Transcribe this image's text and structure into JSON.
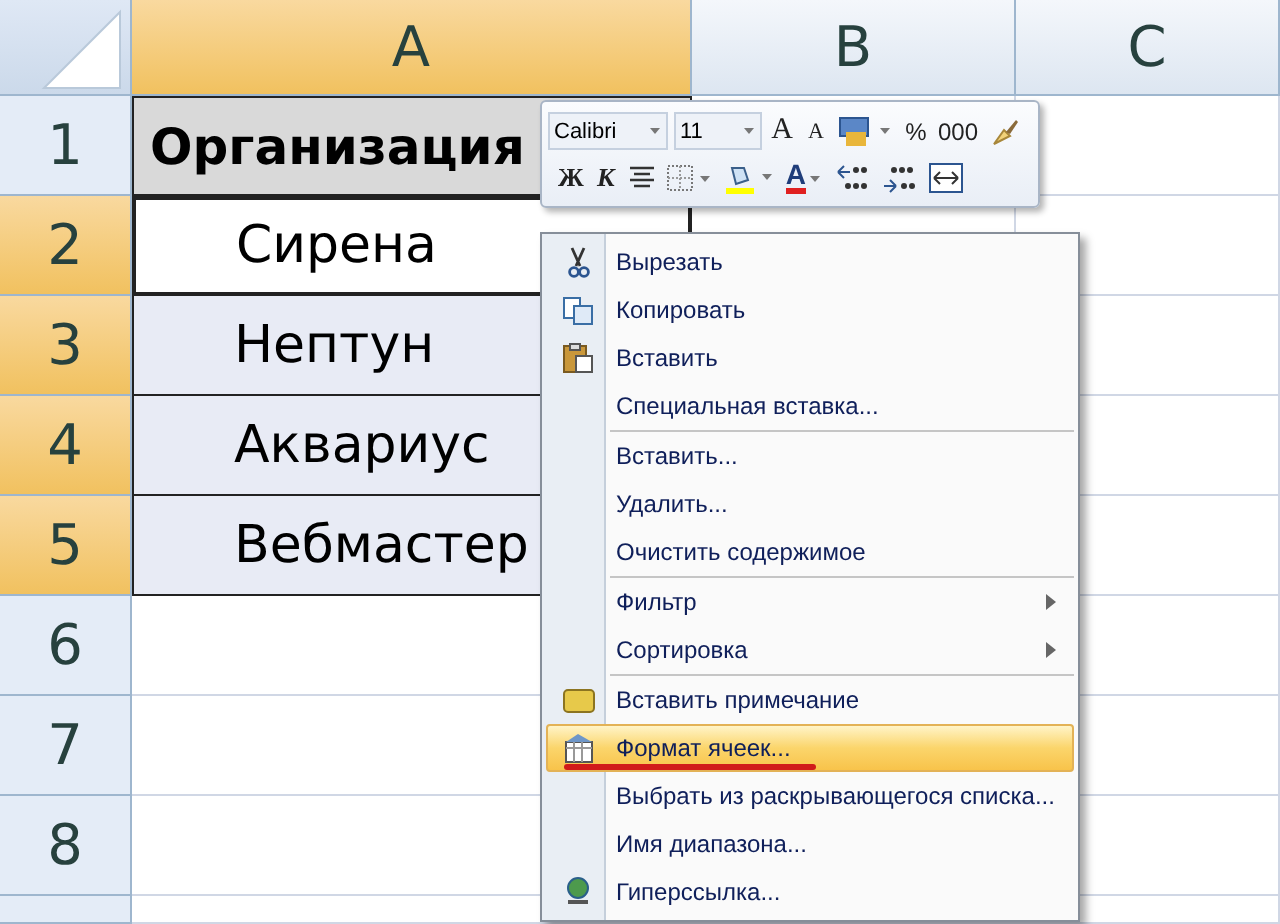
{
  "sheet": {
    "columns": [
      {
        "label": "A",
        "selected": true
      },
      {
        "label": "B",
        "selected": false
      },
      {
        "label": "C",
        "selected": false
      }
    ],
    "rows": [
      {
        "number": "1",
        "selected": false,
        "cells": [
          {
            "text": "Организация",
            "kind": "header",
            "active": false
          }
        ]
      },
      {
        "number": "2",
        "selected": true,
        "cells": [
          {
            "text": "Сирена",
            "kind": "data",
            "active": true
          }
        ]
      },
      {
        "number": "3",
        "selected": true,
        "cells": [
          {
            "text": "Нептун",
            "kind": "data",
            "active": false
          }
        ]
      },
      {
        "number": "4",
        "selected": true,
        "cells": [
          {
            "text": "Аквариус",
            "kind": "data",
            "active": false
          }
        ]
      },
      {
        "number": "5",
        "selected": true,
        "cells": [
          {
            "text": "Вебмастер",
            "kind": "data",
            "active": false
          }
        ]
      },
      {
        "number": "6",
        "selected": false,
        "cells": []
      },
      {
        "number": "7",
        "selected": false,
        "cells": []
      },
      {
        "number": "8",
        "selected": false,
        "cells": []
      }
    ]
  },
  "mini_toolbar": {
    "font": "Calibri",
    "size": "11",
    "row_1": [
      {
        "kind": "grow",
        "label": "A"
      },
      {
        "kind": "shrink",
        "label": "A"
      },
      {
        "kind": "styles"
      },
      {
        "kind": "text",
        "label": "%"
      },
      {
        "kind": "text",
        "label": "000"
      },
      {
        "kind": "brush"
      }
    ],
    "row_2": [
      {
        "kind": "bold",
        "label": "Ж"
      },
      {
        "kind": "italic",
        "label": "К"
      },
      {
        "kind": "center"
      },
      {
        "kind": "borders"
      },
      {
        "kind": "fill"
      },
      {
        "kind": "fontcolor",
        "label": "A"
      },
      {
        "kind": "incdec"
      },
      {
        "kind": "decdec"
      },
      {
        "kind": "merge"
      }
    ]
  },
  "context_menu": [
    {
      "kind": "item",
      "label": "Вырезать",
      "submenu": false,
      "highlighted": false,
      "annotated": false
    },
    {
      "kind": "item",
      "label": "Копировать",
      "submenu": false,
      "highlighted": false,
      "annotated": false
    },
    {
      "kind": "item",
      "label": "Вставить",
      "submenu": false,
      "highlighted": false,
      "annotated": false
    },
    {
      "kind": "item",
      "label": "Специальная вставка...",
      "submenu": false,
      "highlighted": false,
      "annotated": false
    },
    {
      "kind": "separator"
    },
    {
      "kind": "item",
      "label": "Вставить...",
      "submenu": false,
      "highlighted": false,
      "annotated": false
    },
    {
      "kind": "item",
      "label": "Удалить...",
      "submenu": false,
      "highlighted": false,
      "annotated": false
    },
    {
      "kind": "item",
      "label": "Очистить содержимое",
      "submenu": false,
      "highlighted": false,
      "annotated": false
    },
    {
      "kind": "separator"
    },
    {
      "kind": "item",
      "label": "Фильтр",
      "submenu": true,
      "highlighted": false,
      "annotated": false
    },
    {
      "kind": "item",
      "label": "Сортировка",
      "submenu": true,
      "highlighted": false,
      "annotated": false
    },
    {
      "kind": "separator"
    },
    {
      "kind": "item",
      "label": "Вставить примечание",
      "submenu": false,
      "highlighted": false,
      "annotated": false
    },
    {
      "kind": "item",
      "label": "Формат ячеек...",
      "submenu": false,
      "highlighted": true,
      "annotated": true
    },
    {
      "kind": "item",
      "label": "Выбрать из раскрывающегося списка...",
      "submenu": false,
      "highlighted": false,
      "annotated": false
    },
    {
      "kind": "item",
      "label": "Имя диапазона...",
      "submenu": false,
      "highlighted": false,
      "annotated": false
    },
    {
      "kind": "item",
      "label": "Гиперссылка...",
      "submenu": false,
      "highlighted": false,
      "annotated": false
    }
  ]
}
